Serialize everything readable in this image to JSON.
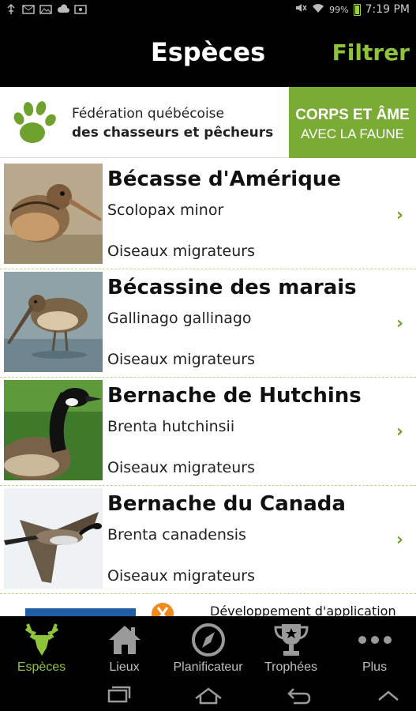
{
  "status_bar": {
    "battery_percent": "99%",
    "time": "7:19 PM"
  },
  "header": {
    "title": "Espèces",
    "filter_label": "Filtrer"
  },
  "banner": {
    "org_line1": "Fédération québécoise",
    "org_line2": "des chasseurs et pêcheurs",
    "slogan_line1": "CORPS ET ÂME",
    "slogan_line2": "AVEC LA FAUNE",
    "accent_color": "#7aab35"
  },
  "species": [
    {
      "name": "Bécasse d'Amérique",
      "scientific": "Scolopax minor",
      "category": "Oiseaux migrateurs",
      "image": "woodcock-photo"
    },
    {
      "name": "Bécassine des marais",
      "scientific": "Gallinago gallinago",
      "category": "Oiseaux migrateurs",
      "image": "snipe-photo"
    },
    {
      "name": "Bernache de Hutchins",
      "scientific": "Brenta hutchinsii",
      "category": "Oiseaux migrateurs",
      "image": "goose-photo"
    },
    {
      "name": "Bernache du Canada",
      "scientific": "Brenta canadensis",
      "category": "Oiseaux migrateurs",
      "image": "flying-goose-photo"
    }
  ],
  "ad": {
    "text": "Développement d'application"
  },
  "tabs": [
    {
      "label": "Espèces",
      "icon": "deer-head-icon",
      "active": true
    },
    {
      "label": "Lieux",
      "icon": "house-icon",
      "active": false
    },
    {
      "label": "Planificateur",
      "icon": "compass-icon",
      "active": false
    },
    {
      "label": "Trophées",
      "icon": "trophy-icon",
      "active": false
    },
    {
      "label": "Plus",
      "icon": "more-dots-icon",
      "active": false
    }
  ],
  "colors": {
    "brand_green": "#8fc33a",
    "list_divider": "#b9d58c"
  }
}
